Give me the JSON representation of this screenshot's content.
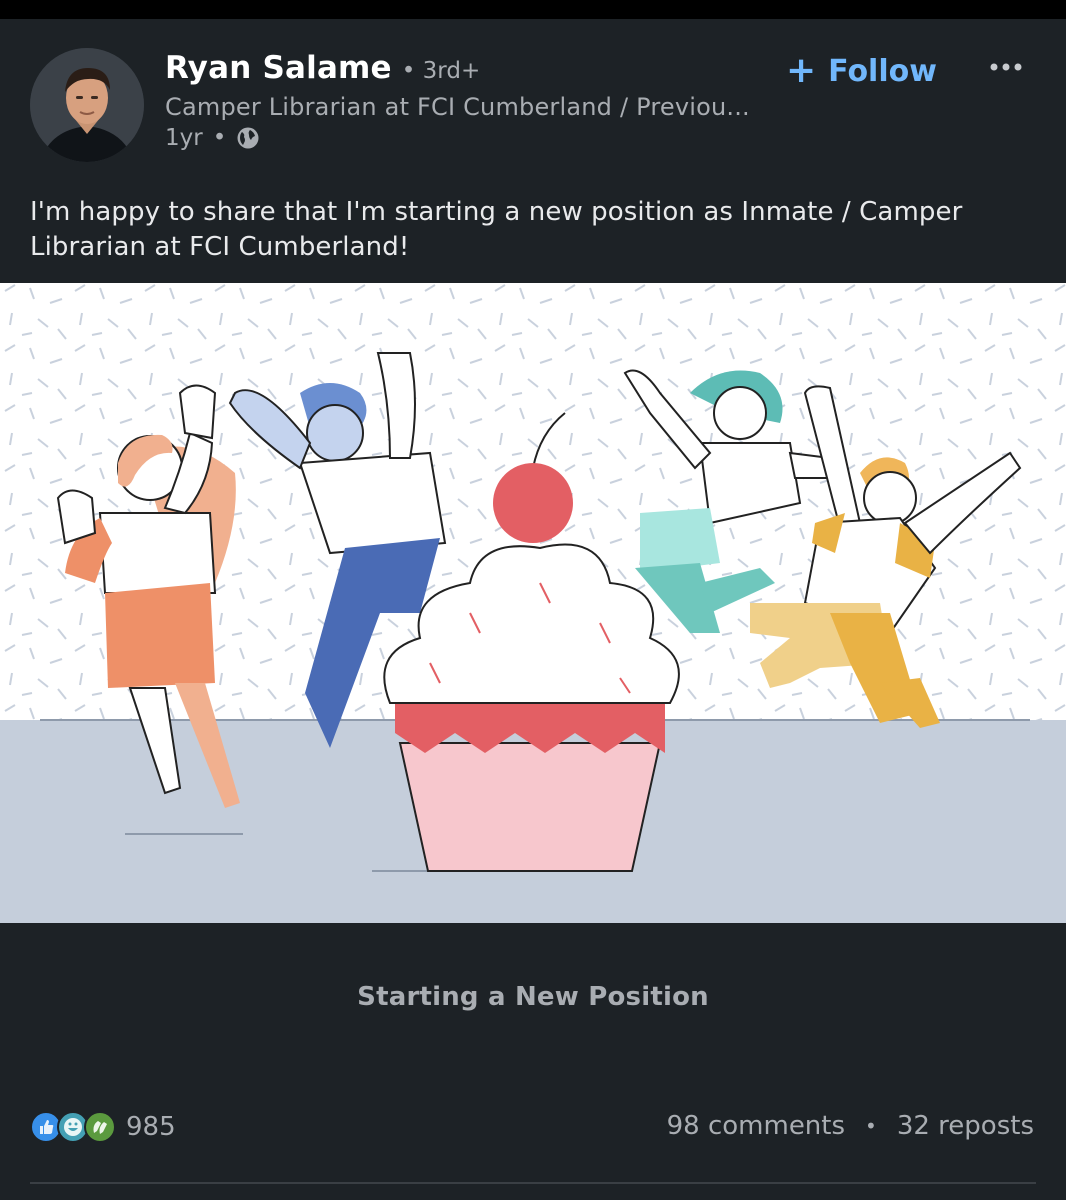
{
  "post": {
    "author_name": "Ryan Salame",
    "connection_degree": "• 3rd+",
    "headline": "Camper Librarian at FCI Cumberland / Previou...",
    "age": "1yr",
    "meta_sep": "•",
    "visibility_icon": "globe-icon",
    "follow_plus": "+",
    "follow_label": "Follow",
    "more_icon": "more-horizontal-icon",
    "text": "I'm happy to share that I'm starting a new position as Inmate / Camper Librarian at FCI Cumberland!"
  },
  "image": {
    "title": "Starting a New Position"
  },
  "social": {
    "reaction_icons": [
      "like-icon",
      "funny-icon",
      "celebrate-icon"
    ],
    "reaction_count": "985",
    "comments": "98 comments",
    "dot": "•",
    "reposts": "32 reposts"
  },
  "colors": {
    "background": "#1d2226",
    "accent": "#71b7fb",
    "muted_text": "#a9adb2"
  }
}
